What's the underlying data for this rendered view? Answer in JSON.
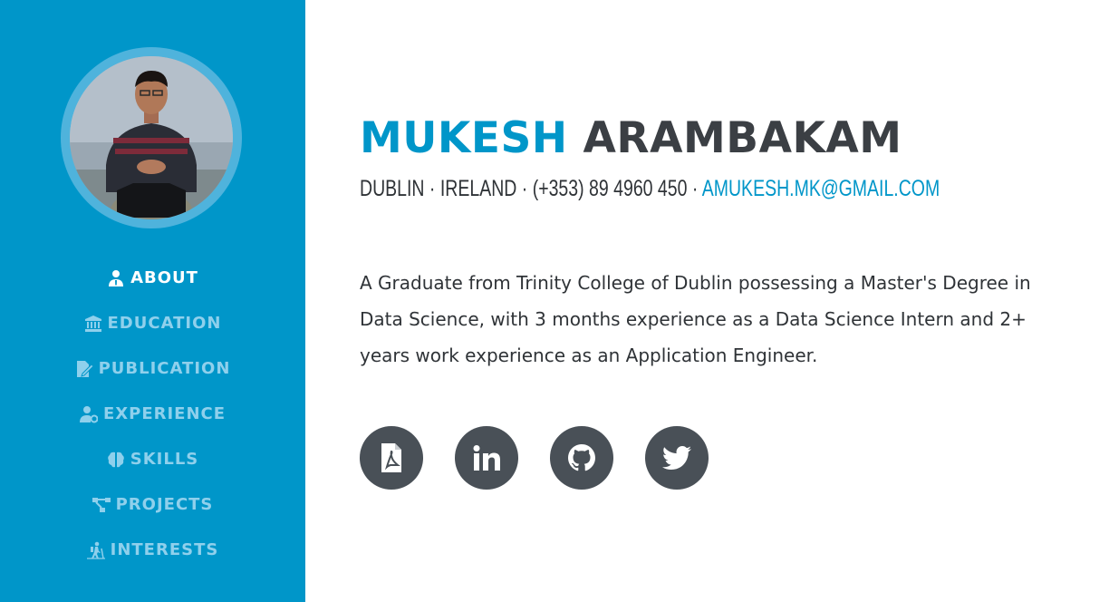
{
  "profile": {
    "first_name": "MUKESH",
    "last_name": "ARAMBAKAM",
    "location": "DUBLIN · IRELAND · (+353) 89 4960 450 · ",
    "email": "AMUKESH.MK@GMAIL.COM",
    "bio": "A Graduate from Trinity College of Dublin possessing a Master's Degree in Data Science, with 3 months experience as a Data Science Intern and 2+ years work experience as an Application Engineer."
  },
  "nav": {
    "items": [
      {
        "label": "ABOUT",
        "icon": "user-tie-icon",
        "active": true
      },
      {
        "label": "EDUCATION",
        "icon": "university-icon",
        "active": false
      },
      {
        "label": "PUBLICATION",
        "icon": "file-signature-icon",
        "active": false
      },
      {
        "label": "EXPERIENCE",
        "icon": "user-cog-icon",
        "active": false
      },
      {
        "label": "SKILLS",
        "icon": "brain-icon",
        "active": false
      },
      {
        "label": "PROJECTS",
        "icon": "project-diagram-icon",
        "active": false
      },
      {
        "label": "INTERESTS",
        "icon": "hiking-icon",
        "active": false
      }
    ]
  },
  "social": [
    {
      "name": "resume-pdf",
      "icon": "file-pdf-icon"
    },
    {
      "name": "linkedin",
      "icon": "linkedin-icon"
    },
    {
      "name": "github",
      "icon": "github-icon"
    },
    {
      "name": "twitter",
      "icon": "twitter-icon"
    }
  ],
  "colors": {
    "sidebar": "#0096c9",
    "accent": "#0096c9",
    "text_dark": "#3b3f44",
    "nav_inactive": "#8fd0ec",
    "social_bg": "#495057"
  }
}
